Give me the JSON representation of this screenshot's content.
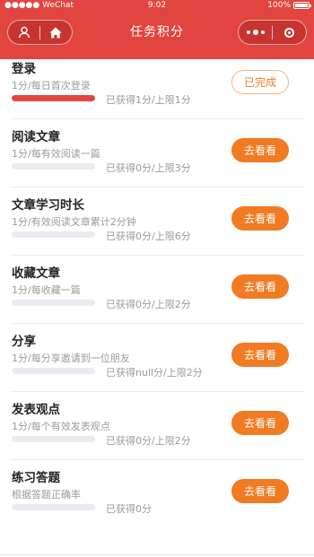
{
  "status_bar": {
    "carrier": "●●●●● WeChat",
    "time": "9:02",
    "battery": "100%"
  },
  "nav": {
    "title": "任务积分",
    "left_icons": [
      "user-icon",
      "home-icon"
    ],
    "right_icons": [
      "more-dots-icon",
      "close-target-icon"
    ]
  },
  "colors": {
    "header": "#e24540",
    "button": "#f07b22",
    "progress_fill": "#e24540",
    "progress_track": "#e9ebf1"
  },
  "tasks": [
    {
      "title": "登录",
      "desc": "1分/每日首次登录",
      "progress": "已获得1分/上限1分",
      "progress_fraction": 1,
      "button": "已完成",
      "state": "done"
    },
    {
      "title": "阅读文章",
      "desc": "1分/每有效阅读一篇",
      "progress": "已获得0分/上限3分",
      "progress_fraction": 0,
      "button": "去看看",
      "state": "go"
    },
    {
      "title": "文章学习时长",
      "desc": "1分/有效阅读文章累计2分钟",
      "progress": "已获得0分/上限6分",
      "progress_fraction": 0,
      "button": "去看看",
      "state": "go"
    },
    {
      "title": "收藏文章",
      "desc": "1分/每收藏一篇",
      "progress": "已获得0分/上限2分",
      "progress_fraction": 0,
      "button": "去看看",
      "state": "go"
    },
    {
      "title": "分享",
      "desc": "1分/每分享邀请到一位朋友",
      "progress": "已获得null分/上限2分",
      "progress_fraction": 0,
      "button": "去看看",
      "state": "go"
    },
    {
      "title": "发表观点",
      "desc": "1分/每个有效发表观点",
      "progress": "已获得0分/上限2分",
      "progress_fraction": 0,
      "button": "去看看",
      "state": "go"
    },
    {
      "title": "练习答题",
      "desc": "根据答题正确率",
      "progress": "已获得0分",
      "progress_fraction": 0,
      "button": "去看看",
      "state": "go"
    }
  ]
}
